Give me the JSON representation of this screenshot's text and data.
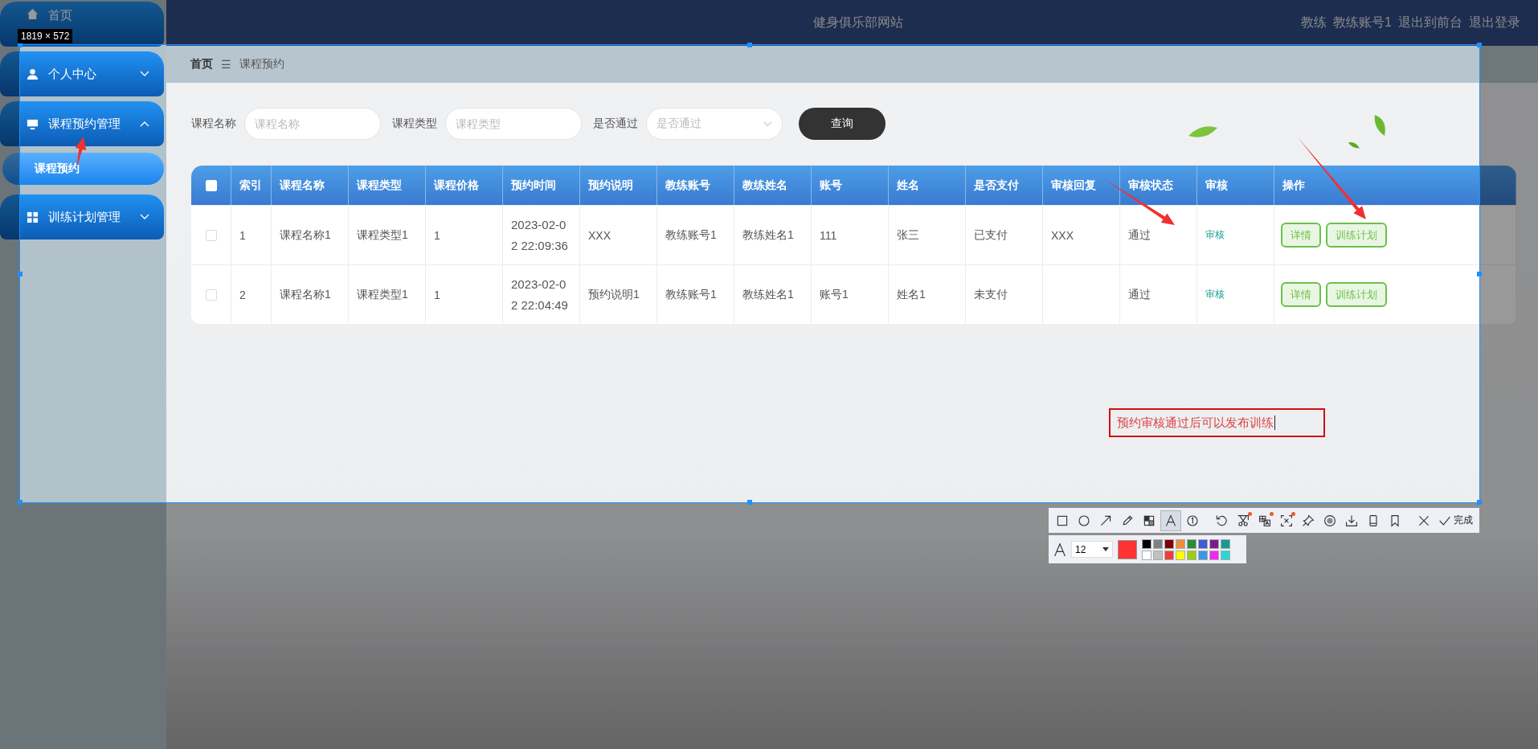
{
  "header": {
    "title": "健身俱乐部网站",
    "role": "教练",
    "account": "教练账号1",
    "links": [
      "退出到前台",
      "退出登录"
    ]
  },
  "sidebar": {
    "items": [
      {
        "label": "首页",
        "kind": "link"
      },
      {
        "label": "个人中心",
        "kind": "menu",
        "expanded": false
      },
      {
        "label": "课程预约管理",
        "kind": "menu",
        "expanded": true,
        "children": [
          {
            "label": "课程预约",
            "selected": true
          }
        ]
      },
      {
        "label": "训练计划管理",
        "kind": "menu",
        "expanded": false
      }
    ]
  },
  "breadcrumb": {
    "items": [
      "首页",
      "课程预约"
    ],
    "separator": "☰"
  },
  "search": {
    "fields": [
      {
        "label": "课程名称",
        "placeholder": "课程名称",
        "kind": "input"
      },
      {
        "label": "课程类型",
        "placeholder": "课程类型",
        "kind": "input"
      },
      {
        "label": "是否通过",
        "placeholder": "是否通过",
        "kind": "select"
      }
    ],
    "button": "查询"
  },
  "table": {
    "all_checked": false,
    "columns": [
      "索引",
      "课程名称",
      "课程类型",
      "课程价格",
      "预约时间",
      "预约说明",
      "教练账号",
      "教练姓名",
      "账号",
      "姓名",
      "是否支付",
      "审核回复",
      "审核状态",
      "审核",
      "操作"
    ],
    "rows": [
      {
        "checked": false,
        "cells": [
          "1",
          "课程名称1",
          "课程类型1",
          "1",
          "2023-02-02 22:09:36",
          "XXX",
          "教练账号1",
          "教练姓名1",
          "111",
          "张三",
          "已支付",
          "XXX",
          "通过"
        ],
        "review": "审核",
        "actions": [
          "详情",
          "训练计划"
        ]
      },
      {
        "checked": false,
        "cells": [
          "2",
          "课程名称1",
          "课程类型1",
          "1",
          "2023-02-02 22:04:49",
          "预约说明1",
          "教练账号1",
          "教练姓名1",
          "账号1",
          "姓名1",
          "未支付",
          null,
          "通过"
        ],
        "review": "审核",
        "actions": [
          "详情",
          "训练计划"
        ]
      }
    ]
  },
  "capture": {
    "size_label": "1819 × 572",
    "annotation_text": "预约审核通过后可以发布训练",
    "tools": [
      {
        "kind": "rect",
        "selected": false,
        "badge": false
      },
      {
        "kind": "circle",
        "selected": false,
        "badge": false
      },
      {
        "kind": "arrow",
        "selected": false,
        "badge": false
      },
      {
        "kind": "pencil",
        "selected": false,
        "badge": false
      },
      {
        "kind": "mosaic",
        "selected": false,
        "badge": false
      },
      {
        "kind": "text",
        "selected": true,
        "badge": false
      },
      {
        "kind": "number",
        "selected": false,
        "badge": false
      },
      {
        "kind": "undo",
        "selected": false,
        "badge": false
      },
      {
        "kind": "cut",
        "selected": false,
        "badge": true
      },
      {
        "kind": "ocr",
        "selected": false,
        "badge": true
      },
      {
        "kind": "translate",
        "selected": false,
        "badge": true
      },
      {
        "kind": "pin",
        "selected": false,
        "badge": false
      },
      {
        "kind": "record",
        "selected": false,
        "badge": false
      },
      {
        "kind": "download",
        "selected": false,
        "badge": false
      },
      {
        "kind": "phone",
        "selected": false,
        "badge": false
      },
      {
        "kind": "bookmark",
        "selected": false,
        "badge": false
      },
      {
        "kind": "close",
        "selected": false,
        "badge": false
      }
    ],
    "done_label": "完成",
    "font_size": "12",
    "palette": [
      {
        "color": "#000000"
      },
      {
        "color": "#808080"
      },
      {
        "color": "#800000"
      },
      {
        "color": "#f08c3c"
      },
      {
        "color": "#2e8b3c"
      },
      {
        "color": "#3c5cd8"
      },
      {
        "color": "#7a1c8c"
      },
      {
        "color": "#149c94"
      },
      {
        "color": "#ffffff"
      },
      {
        "color": "#c0c0c0"
      },
      {
        "color": "#f03c3c"
      },
      {
        "color": "#ffff00"
      },
      {
        "color": "#9ccc14"
      },
      {
        "color": "#3c96e8"
      },
      {
        "color": "#f028f0"
      },
      {
        "color": "#28d8d8"
      }
    ]
  }
}
